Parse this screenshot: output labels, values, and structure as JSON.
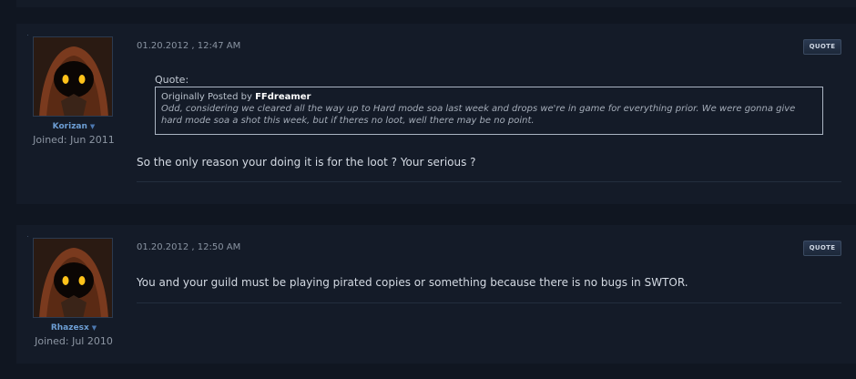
{
  "posts": [
    {
      "username": "Korizan",
      "joined": "Joined: Jun 2011",
      "date": "01.20.2012 , 12:47 AM",
      "quote_button": "QUOTE",
      "quote": {
        "label": "Quote:",
        "prefix": "Originally Posted by",
        "author": "FFdreamer",
        "text": "Odd, considering we cleared all the way up to Hard mode soa last week and drops we're in game for everything prior. We were gonna give hard mode soa a shot this week, but if theres no loot, well there may be no point."
      },
      "message": "So the only reason your doing it is for the loot ? Your serious ?"
    },
    {
      "username": "Rhazesx",
      "joined": "Joined: Jul 2010",
      "date": "01.20.2012 , 12:50 AM",
      "quote_button": "QUOTE",
      "message": "You and your guild must be playing pirated copies or something because there is no bugs in SWTOR."
    }
  ],
  "icons": {
    "user_menu": "caret-down-icon",
    "avatar": "hooded-jawa-avatar"
  },
  "colors": {
    "background": "#101621",
    "post_background": "#141b28",
    "username": "#6d9ed4",
    "quote_author": "#ffffff"
  }
}
